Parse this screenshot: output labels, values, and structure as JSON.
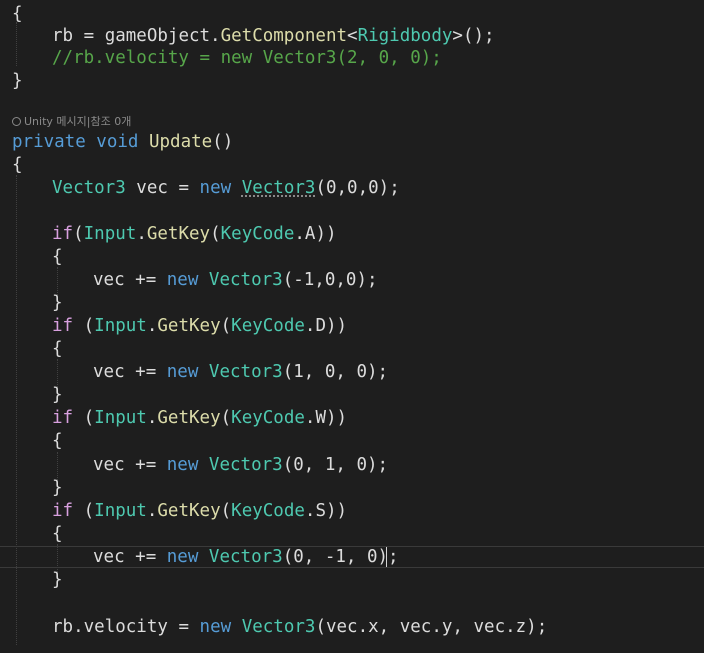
{
  "editor": {
    "codelens": "Unity 메시지|참조 0개",
    "codelens_icon": "unity-icon",
    "lines": [
      {
        "id": "l1",
        "tokens": [
          {
            "t": "{",
            "c": "brace"
          }
        ]
      },
      {
        "id": "l2",
        "tokens": [
          {
            "t": "rb ",
            "c": "txt"
          },
          {
            "t": "= ",
            "c": "txt"
          },
          {
            "t": "gameObject",
            "c": "txt"
          },
          {
            "t": ".",
            "c": "txt"
          },
          {
            "t": "GetComponent",
            "c": "fn"
          },
          {
            "t": "<",
            "c": "txt"
          },
          {
            "t": "Rigidbody",
            "c": "cls"
          },
          {
            "t": ">();",
            "c": "txt"
          }
        ]
      },
      {
        "id": "l3",
        "tokens": [
          {
            "t": "//rb.velocity = new Vector3(2, 0, 0);",
            "c": "cmt"
          }
        ]
      },
      {
        "id": "l4",
        "tokens": [
          {
            "t": "}",
            "c": "brace"
          }
        ]
      },
      {
        "id": "l5",
        "tokens": [
          {
            "t": "private ",
            "c": "kw"
          },
          {
            "t": "void ",
            "c": "kw"
          },
          {
            "t": "Update",
            "c": "fn"
          },
          {
            "t": "()",
            "c": "txt"
          }
        ]
      },
      {
        "id": "l6",
        "tokens": [
          {
            "t": "{",
            "c": "brace"
          }
        ]
      },
      {
        "id": "l7",
        "tokens": [
          {
            "t": "Vector3 ",
            "c": "cls"
          },
          {
            "t": "vec ",
            "c": "txt"
          },
          {
            "t": "= ",
            "c": "txt"
          },
          {
            "t": "new ",
            "c": "kw"
          },
          {
            "t": "Vector3",
            "c": "cls",
            "sq": true
          },
          {
            "t": "(0,0,0);",
            "c": "txt"
          }
        ]
      },
      {
        "id": "l8",
        "tokens": [
          {
            "t": "if",
            "c": "ctl"
          },
          {
            "t": "(",
            "c": "txt"
          },
          {
            "t": "Input",
            "c": "cls"
          },
          {
            "t": ".",
            "c": "txt"
          },
          {
            "t": "GetKey",
            "c": "fn"
          },
          {
            "t": "(",
            "c": "txt"
          },
          {
            "t": "KeyCode",
            "c": "cls"
          },
          {
            "t": ".A))",
            "c": "txt"
          }
        ]
      },
      {
        "id": "l9",
        "tokens": [
          {
            "t": "{",
            "c": "brace"
          }
        ]
      },
      {
        "id": "l10",
        "tokens": [
          {
            "t": "vec ",
            "c": "txt"
          },
          {
            "t": "+= ",
            "c": "txt"
          },
          {
            "t": "new ",
            "c": "kw"
          },
          {
            "t": "Vector3",
            "c": "cls"
          },
          {
            "t": "(-1,0,0);",
            "c": "txt"
          }
        ]
      },
      {
        "id": "l11",
        "tokens": [
          {
            "t": "}",
            "c": "brace"
          }
        ]
      },
      {
        "id": "l12",
        "tokens": [
          {
            "t": "if ",
            "c": "ctl"
          },
          {
            "t": "(",
            "c": "txt"
          },
          {
            "t": "Input",
            "c": "cls"
          },
          {
            "t": ".",
            "c": "txt"
          },
          {
            "t": "GetKey",
            "c": "fn"
          },
          {
            "t": "(",
            "c": "txt"
          },
          {
            "t": "KeyCode",
            "c": "cls"
          },
          {
            "t": ".D))",
            "c": "txt"
          }
        ]
      },
      {
        "id": "l13",
        "tokens": [
          {
            "t": "{",
            "c": "brace"
          }
        ]
      },
      {
        "id": "l14",
        "tokens": [
          {
            "t": "vec ",
            "c": "txt"
          },
          {
            "t": "+= ",
            "c": "txt"
          },
          {
            "t": "new ",
            "c": "kw"
          },
          {
            "t": "Vector3",
            "c": "cls"
          },
          {
            "t": "(1, 0, 0);",
            "c": "txt"
          }
        ]
      },
      {
        "id": "l15",
        "tokens": [
          {
            "t": "}",
            "c": "brace"
          }
        ]
      },
      {
        "id": "l16",
        "tokens": [
          {
            "t": "if ",
            "c": "ctl"
          },
          {
            "t": "(",
            "c": "txt"
          },
          {
            "t": "Input",
            "c": "cls"
          },
          {
            "t": ".",
            "c": "txt"
          },
          {
            "t": "GetKey",
            "c": "fn"
          },
          {
            "t": "(",
            "c": "txt"
          },
          {
            "t": "KeyCode",
            "c": "cls"
          },
          {
            "t": ".W))",
            "c": "txt"
          }
        ]
      },
      {
        "id": "l17",
        "tokens": [
          {
            "t": "{",
            "c": "brace"
          }
        ]
      },
      {
        "id": "l18",
        "tokens": [
          {
            "t": "vec ",
            "c": "txt"
          },
          {
            "t": "+= ",
            "c": "txt"
          },
          {
            "t": "new ",
            "c": "kw"
          },
          {
            "t": "Vector3",
            "c": "cls"
          },
          {
            "t": "(0, 1, 0);",
            "c": "txt"
          }
        ]
      },
      {
        "id": "l19",
        "tokens": [
          {
            "t": "}",
            "c": "brace"
          }
        ]
      },
      {
        "id": "l20",
        "tokens": [
          {
            "t": "if ",
            "c": "ctl"
          },
          {
            "t": "(",
            "c": "txt"
          },
          {
            "t": "Input",
            "c": "cls"
          },
          {
            "t": ".",
            "c": "txt"
          },
          {
            "t": "GetKey",
            "c": "fn"
          },
          {
            "t": "(",
            "c": "txt"
          },
          {
            "t": "KeyCode",
            "c": "cls"
          },
          {
            "t": ".S))",
            "c": "txt"
          }
        ]
      },
      {
        "id": "l21",
        "tokens": [
          {
            "t": "{",
            "c": "brace"
          }
        ]
      },
      {
        "id": "l22",
        "tokens": [
          {
            "t": "vec ",
            "c": "txt"
          },
          {
            "t": "+= ",
            "c": "txt"
          },
          {
            "t": "new ",
            "c": "kw"
          },
          {
            "t": "Vector3",
            "c": "cls"
          },
          {
            "t": "(0, -1, 0);",
            "c": "txt"
          }
        ]
      },
      {
        "id": "l23",
        "tokens": [
          {
            "t": "}",
            "c": "brace"
          }
        ]
      },
      {
        "id": "l24",
        "tokens": [
          {
            "t": "rb",
            "c": "txt"
          },
          {
            "t": ".",
            "c": "txt"
          },
          {
            "t": "velocity ",
            "c": "txt"
          },
          {
            "t": "= ",
            "c": "txt"
          },
          {
            "t": "new ",
            "c": "kw"
          },
          {
            "t": "Vector3",
            "c": "cls"
          },
          {
            "t": "(vec.x, vec.y, vec.z);",
            "c": "txt"
          }
        ]
      }
    ]
  },
  "theme": {
    "background": "#1e1e1e",
    "keyword": "#569cd6",
    "control": "#d8a0df",
    "type": "#4ec9b0",
    "method": "#dcdcaa",
    "comment": "#57a64a",
    "text": "#dcdcdc"
  }
}
